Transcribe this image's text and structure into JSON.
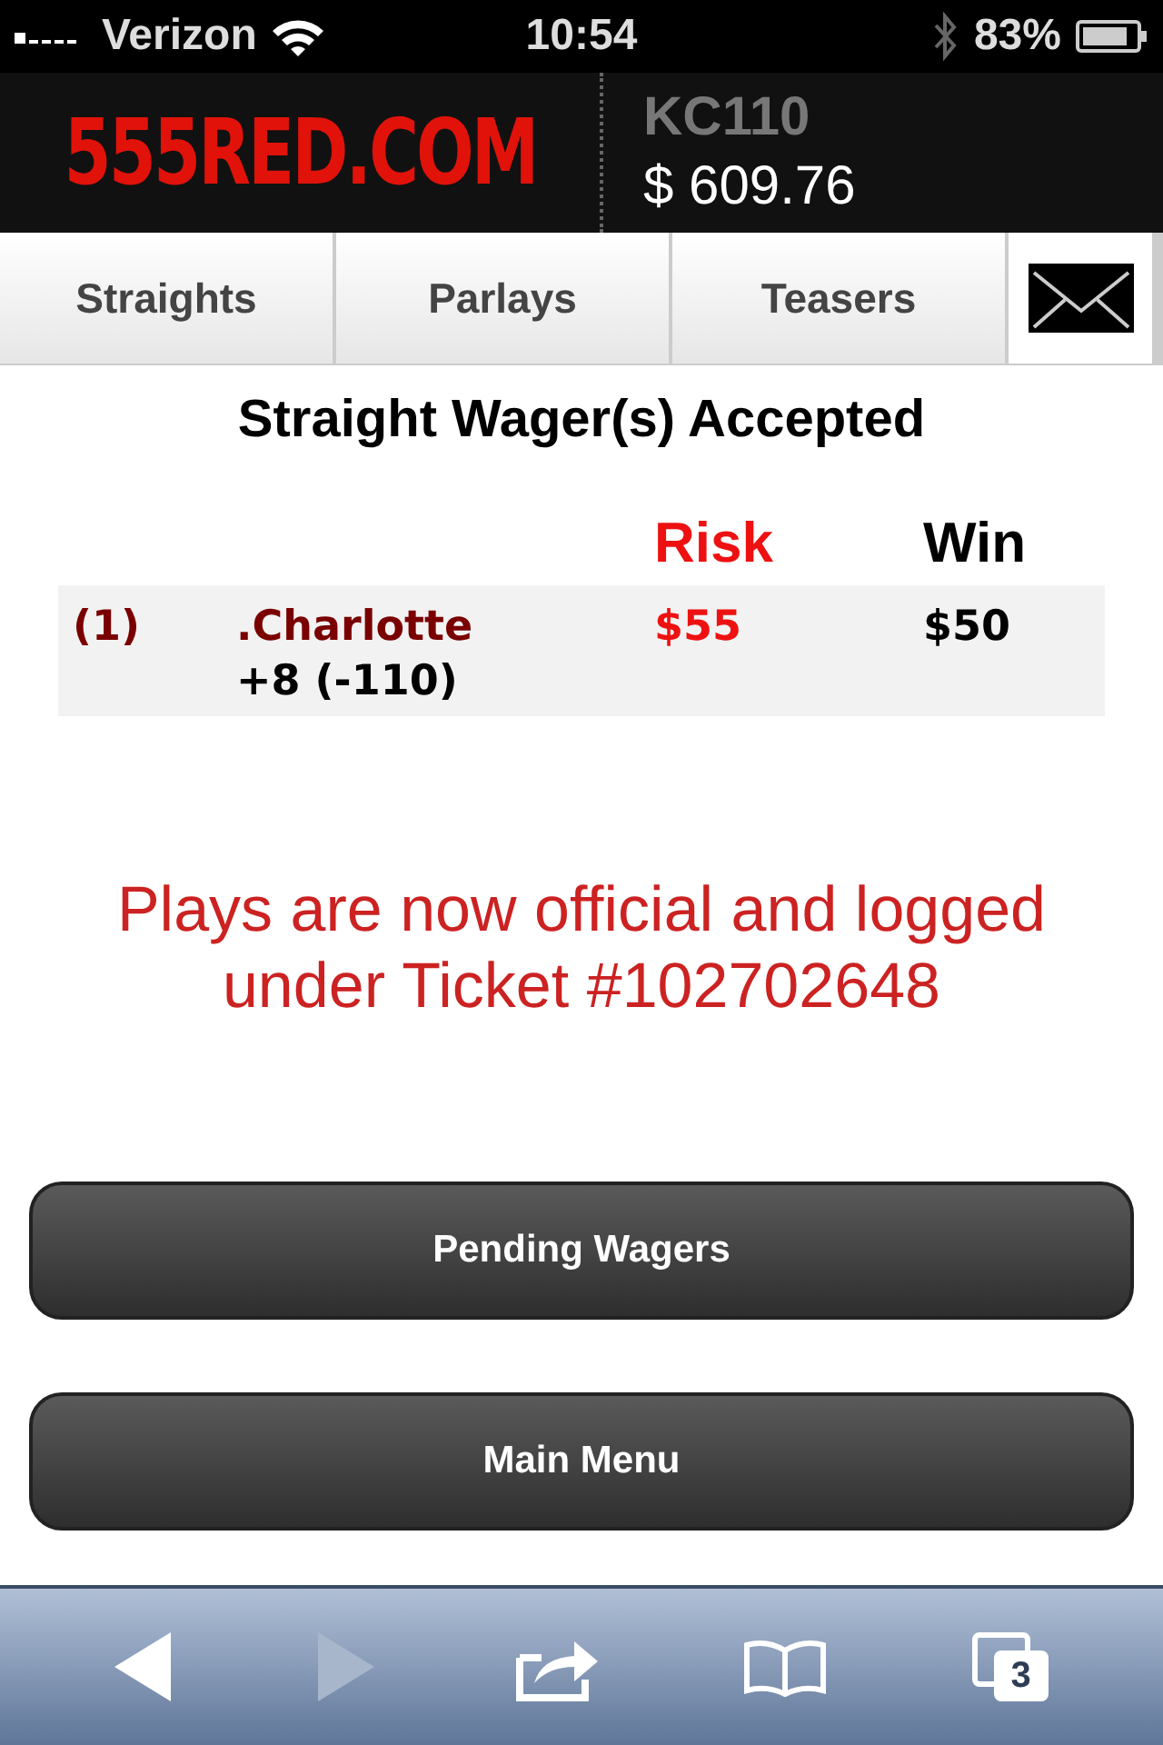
{
  "status_bar": {
    "carrier": "Verizon",
    "time": "10:54",
    "battery": "83%"
  },
  "header": {
    "logo": "555RED.COM",
    "account": "KC110",
    "balance": "$ 609.76"
  },
  "tabs": [
    {
      "label": "Straights",
      "selected": false
    },
    {
      "label": "Parlays",
      "selected": false
    },
    {
      "label": "Teasers",
      "selected": false
    }
  ],
  "title": "Straight Wager(s) Accepted",
  "table": {
    "columns": [
      "Risk",
      "Win"
    ],
    "rows": [
      {
        "number": "(1)",
        "team": ".Charlotte",
        "line": "+8 (-110)",
        "risk": "$55",
        "win": "$50"
      }
    ]
  },
  "message": "Plays are now official and logged under Ticket #102702648",
  "buttons": [
    "Pending Wagers",
    "Main Menu"
  ],
  "toolbar": {
    "tab_count": "3"
  }
}
